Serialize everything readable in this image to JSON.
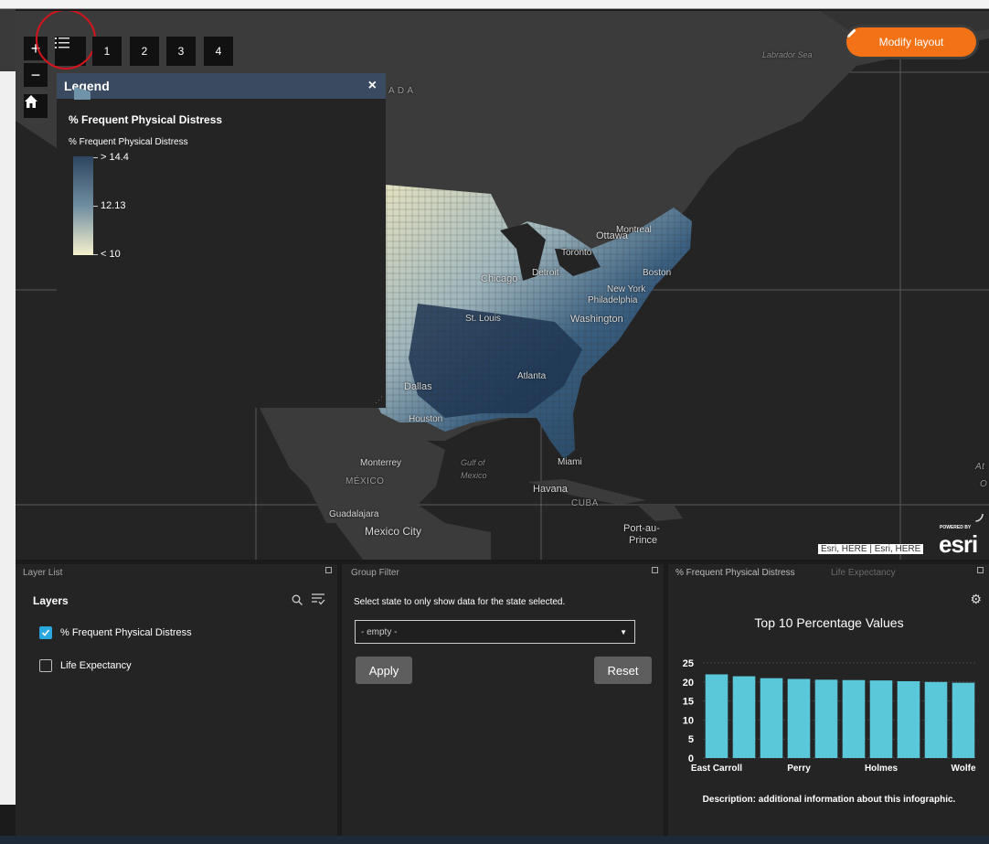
{
  "map": {
    "zoom_in": "+",
    "zoom_out": "−",
    "home_icon": "home-icon",
    "tab_buttons": [
      "1",
      "2",
      "3",
      "4"
    ],
    "modify_layout": "Modify layout",
    "attribution": "Esri, HERE | Esri, HERE",
    "powered_by": "POWERED BY",
    "esri": "esri",
    "labels": {
      "canada": "A D A",
      "labrador_sea": "Labrador Sea",
      "ottawa": "Ottawa",
      "montreal": "Montreal",
      "toronto": "Toronto",
      "chicago": "Chicago",
      "detroit": "Detroit",
      "boston": "Boston",
      "new_york": "New York",
      "philadelphia": "Philadelphia",
      "washington": "Washington",
      "st_louis": "St. Louis",
      "atlanta": "Atlanta",
      "dallas": "Dallas",
      "houston": "Houston",
      "monterrey": "Monterrey",
      "mexico": "MÉXICO",
      "gulf": "Gulf of",
      "gulf2": "Mexico",
      "miami": "Miami",
      "havana": "Havana",
      "cuba": "CUBA",
      "guadalajara": "Guadalajara",
      "mexico_city": "Mexico City",
      "port_au": "Port-au-",
      "prince": "Prince",
      "at": "At",
      "o": "O"
    }
  },
  "legend": {
    "title": "Legend",
    "layer_title": "% Frequent Physical Distress",
    "field": "% Frequent Physical Distress",
    "ramp": {
      "high": "> 14.4",
      "mid": "12.13",
      "low": "< 10"
    }
  },
  "layer_list": {
    "panel_title": "Layer List",
    "heading": "Layers",
    "layers": [
      {
        "label": "% Frequent Physical Distress",
        "checked": true
      },
      {
        "label": "Life Expectancy",
        "checked": false
      }
    ]
  },
  "group_filter": {
    "panel_title": "Group Filter",
    "instruction": "Select state to only show data for the state selected.",
    "select_value": "- empty -",
    "apply": "Apply",
    "reset": "Reset"
  },
  "infographic": {
    "tab_active": "% Frequent Physical Distress",
    "tab_inactive": "Life Expectancy",
    "title": "Top 10 Percentage Values",
    "description": "Description: additional information about this infographic."
  },
  "chart_data": {
    "type": "bar",
    "title": "Top 10 Percentage Values",
    "categories": [
      "East Carroll",
      "",
      "",
      "Perry",
      "",
      "",
      "Holmes",
      "",
      "",
      "Wolfe"
    ],
    "values": [
      22,
      21.5,
      21,
      20.8,
      20.6,
      20.5,
      20.4,
      20.2,
      20,
      19.8
    ],
    "ylim": [
      0,
      25
    ],
    "yticks": [
      0,
      5,
      10,
      15,
      20,
      25
    ],
    "color": "#5bc8d9"
  }
}
